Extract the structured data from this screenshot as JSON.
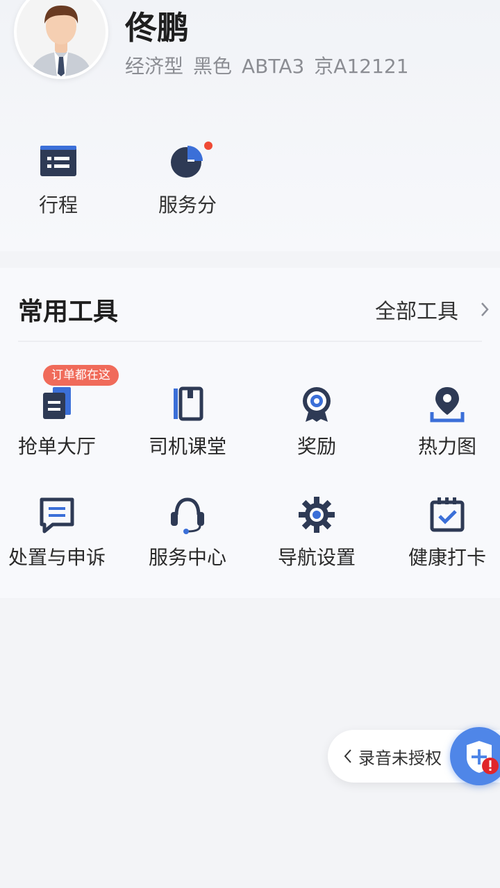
{
  "profile": {
    "name": "佟鹏",
    "car_type": "经济型",
    "car_color": "黑色",
    "car_model": "ABTA3",
    "plate": "京A12121"
  },
  "quick_actions": [
    {
      "label": "行程",
      "icon": "trip-list-icon"
    },
    {
      "label": "服务分",
      "icon": "service-score-pie-icon"
    }
  ],
  "tools": {
    "title": "常用工具",
    "all_label": "全部工具",
    "items": [
      {
        "label": "抢单大厅",
        "icon": "order-hall-icon",
        "badge": "订单都在这"
      },
      {
        "label": "司机课堂",
        "icon": "driver-class-book-icon"
      },
      {
        "label": "奖励",
        "icon": "reward-medal-icon"
      },
      {
        "label": "热力图",
        "icon": "heatmap-location-icon"
      },
      {
        "label": "处置与申诉",
        "icon": "appeal-message-icon"
      },
      {
        "label": "服务中心",
        "icon": "service-headset-icon"
      },
      {
        "label": "导航设置",
        "icon": "navigation-settings-gear-icon"
      },
      {
        "label": "健康打卡",
        "icon": "health-checkin-calendar-icon"
      }
    ]
  },
  "recording": {
    "label": "录音未授权"
  },
  "colors": {
    "accent": "#3b6fd8",
    "dark_icon": "#2e3a55",
    "badge": "#f06b5a",
    "alert": "#e0262b"
  }
}
